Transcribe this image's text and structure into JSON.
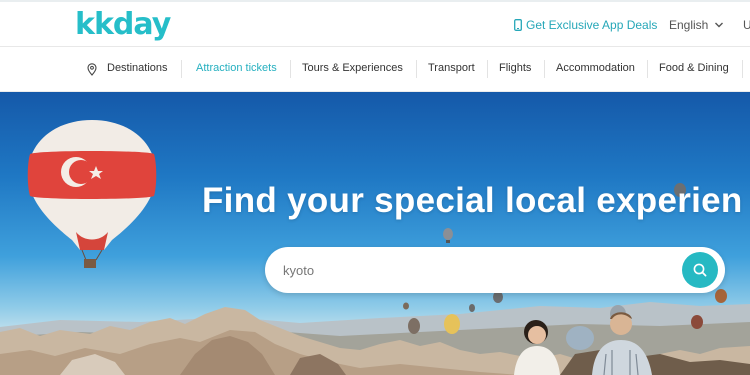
{
  "header": {
    "logo_text": "kkday",
    "app_deals_label": "Get Exclusive App Deals",
    "language_label": "English",
    "currency_label": "U"
  },
  "nav": {
    "items": [
      {
        "label": "Destinations",
        "icon": "map-pin-icon"
      },
      {
        "label": "Attraction tickets",
        "active": true
      },
      {
        "label": "Tours & Experiences"
      },
      {
        "label": "Transport"
      },
      {
        "label": "Flights"
      },
      {
        "label": "Accommodation"
      },
      {
        "label": "Food & Dining"
      }
    ]
  },
  "hero": {
    "headline": "Find your special local experien",
    "search": {
      "value": "kyoto",
      "placeholder": "kyoto"
    },
    "search_icon": "search-icon"
  },
  "colors": {
    "brand": "#26bec9",
    "active_nav": "#26b0c0",
    "search_button": "#26b9c3"
  }
}
